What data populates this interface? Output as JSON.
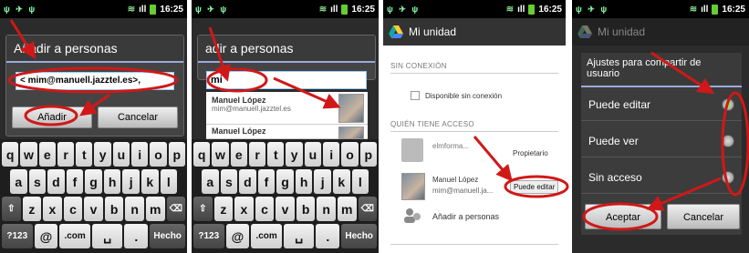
{
  "status": {
    "time": "16:25"
  },
  "panel1": {
    "dialog_title": "Añadir a personas",
    "field_value": "< mim@manuell.jazztel.es>,",
    "add_button": "Añadir",
    "cancel_button": "Cancelar"
  },
  "panel2": {
    "dialog_title": "adir a personas",
    "field_value": "mi",
    "suggestions": [
      {
        "name": "Manuel López",
        "email": "mim@manuell.jazztel.es"
      },
      {
        "name": "Manuel López",
        "email": ""
      }
    ]
  },
  "keyboard": {
    "row1": [
      "q",
      "w",
      "e",
      "r",
      "t",
      "y",
      "u",
      "i",
      "o",
      "p"
    ],
    "row2": [
      "a",
      "s",
      "d",
      "f",
      "g",
      "h",
      "j",
      "k",
      "l"
    ],
    "row3": [
      "⇧",
      "z",
      "x",
      "c",
      "v",
      "b",
      "n",
      "m",
      "⌫"
    ],
    "row4": [
      "?123",
      "@",
      ".com",
      "␣",
      ".",
      "Hecho"
    ]
  },
  "panel3": {
    "app_title": "Mi unidad",
    "offline_header": "SIN CONEXIÓN",
    "offline_option": "Disponible sin conexión",
    "access_header": "QUIÉN TIENE ACCESO",
    "owner_email": "elmforma...",
    "owner_role": "Propietario",
    "user_name": "Manuel López",
    "user_email": "mim@manuell.ja...",
    "user_role": "Puede editar",
    "add_people": "Añadir a personas"
  },
  "panel4": {
    "app_title": "Mi unidad",
    "dialog_title": "Ajustes para compartir de usuario",
    "options": [
      "Puede editar",
      "Puede ver",
      "Sin acceso"
    ],
    "selected_option": "Puede editar",
    "accept_button": "Aceptar",
    "cancel_button": "Cancelar"
  },
  "colors": {
    "annotation_red": "#d01818",
    "accent_blue": "#99aadd",
    "radio_green": "#77ff33"
  }
}
